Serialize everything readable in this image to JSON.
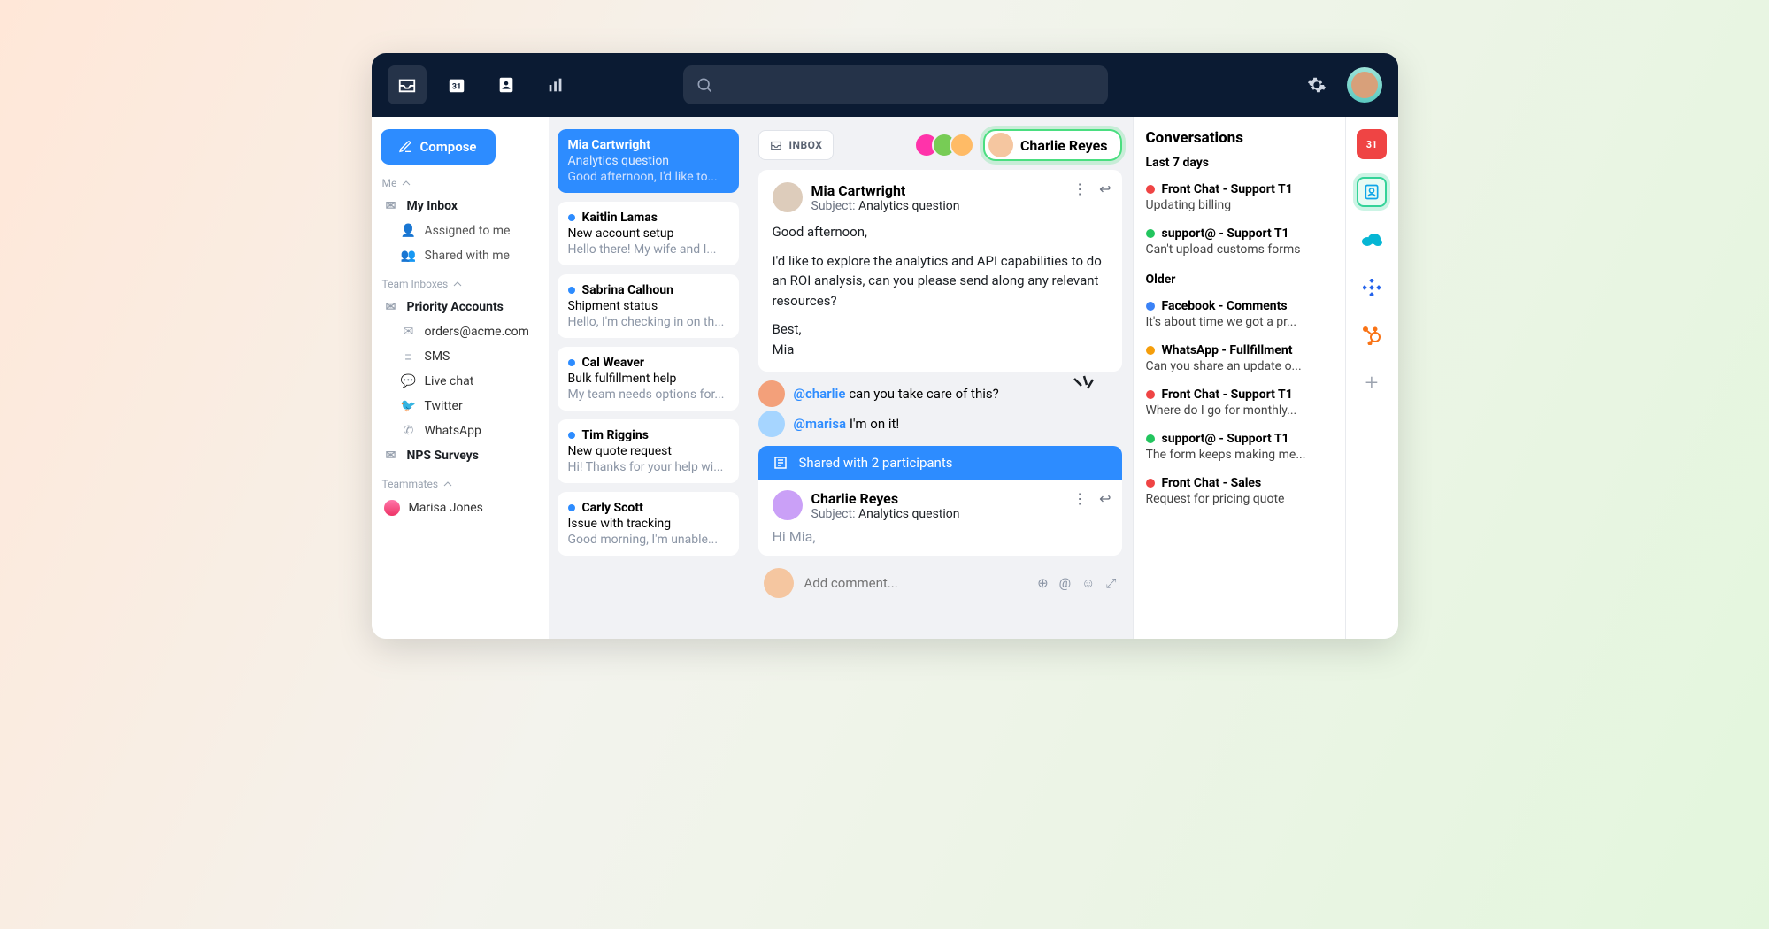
{
  "topnav": {
    "cal_badge": "31"
  },
  "sidebar": {
    "compose": "Compose",
    "me": "Me",
    "my_inbox": "My Inbox",
    "assigned": "Assigned to me",
    "shared": "Shared with me",
    "team": "Team Inboxes",
    "priority": "Priority Accounts",
    "orders": "orders@acme.com",
    "sms": "SMS",
    "chat": "Live chat",
    "twitter": "Twitter",
    "whatsapp": "WhatsApp",
    "nps": "NPS Surveys",
    "teammates": "Teammates",
    "marisa": "Marisa Jones"
  },
  "list": [
    {
      "name": "Mia Cartwright",
      "subject": "Analytics question",
      "preview": "Good afternoon, I'd like to...",
      "active": true
    },
    {
      "name": "Kaitlin Lamas",
      "subject": "New account setup",
      "preview": "Hello there! My wife and I..."
    },
    {
      "name": "Sabrina Calhoun",
      "subject": "Shipment status",
      "preview": "Hello, I'm checking in on th..."
    },
    {
      "name": "Cal Weaver",
      "subject": "Bulk fulfillment help",
      "preview": "My team needs options for..."
    },
    {
      "name": "Tim Riggins",
      "subject": "New quote request",
      "preview": "Hi! Thanks for your help wi..."
    },
    {
      "name": "Carly Scott",
      "subject": "Issue with tracking",
      "preview": "Good morning, I'm unable..."
    }
  ],
  "reader": {
    "inbox_pill": "INBOX",
    "assignee": "Charlie Reyes",
    "from": "Mia Cartwright",
    "subject_label": "Subject:",
    "subject": "Analytics question",
    "body_line1": "Good afternoon,",
    "body_line2": "I'd like to explore the analytics and API capabilities to do an ROI analysis, can you please send along any relevant resources?",
    "body_line3": "Best,",
    "body_line4": "Mia",
    "c1_mention": "@charlie",
    "c1_text": " can you take care of this?",
    "c2_mention": "@marisa",
    "c2_text": " I'm on it!",
    "shared_banner": "Shared with 2 participants",
    "reply_from": "Charlie Reyes",
    "reply_subject": "Analytics question",
    "draft": "Hi Mia,",
    "composer_placeholder": "Add comment..."
  },
  "right": {
    "title": "Conversations",
    "sec1": "Last 7 days",
    "sec2": "Older",
    "items": [
      {
        "dot": "sd-red",
        "title": "Front Chat - Support T1",
        "sub": "Updating billing"
      },
      {
        "dot": "sd-green",
        "title": "support@ - Support T1",
        "sub": "Can't upload customs forms"
      },
      {
        "dot": "sd-blue",
        "title": "Facebook - Comments",
        "sub": "It's about time we got a pr..."
      },
      {
        "dot": "sd-orange",
        "title": "WhatsApp - Fullfillment",
        "sub": "Can you share an update o..."
      },
      {
        "dot": "sd-red",
        "title": "Front Chat - Support T1",
        "sub": "Where do I go for monthly..."
      },
      {
        "dot": "sd-green",
        "title": "support@ - Support T1",
        "sub": "The form keeps making me..."
      },
      {
        "dot": "sd-red",
        "title": "Front Chat - Sales",
        "sub": "Request for pricing quote"
      }
    ]
  },
  "rail": {
    "cal": "31"
  }
}
